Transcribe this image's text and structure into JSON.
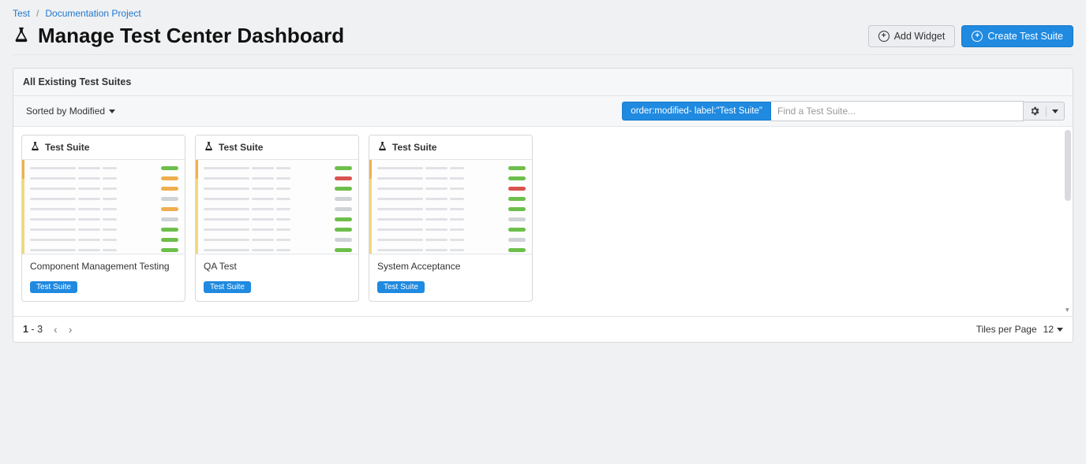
{
  "breadcrumb": {
    "items": [
      {
        "label": "Test"
      },
      {
        "label": "Documentation Project"
      }
    ]
  },
  "page": {
    "title": "Manage Test Center Dashboard"
  },
  "actions": {
    "add_widget": "Add Widget",
    "create_suite": "Create Test Suite"
  },
  "panel": {
    "title": "All Existing Test Suites",
    "sort_label": "Sorted by Modified",
    "filter_chip": "order:modified- label:\"Test Suite\"",
    "search_placeholder": "Find a Test Suite...",
    "card_type_label": "Test Suite",
    "badge_label": "Test Suite",
    "cards": [
      {
        "title": "Component Management Testing"
      },
      {
        "title": "QA Test"
      },
      {
        "title": "System Acceptance"
      }
    ],
    "pagination": {
      "range_start": "1",
      "range_sep": " - ",
      "range_end": "3",
      "tiles_label": "Tiles per Page",
      "tiles_count": "12"
    }
  }
}
